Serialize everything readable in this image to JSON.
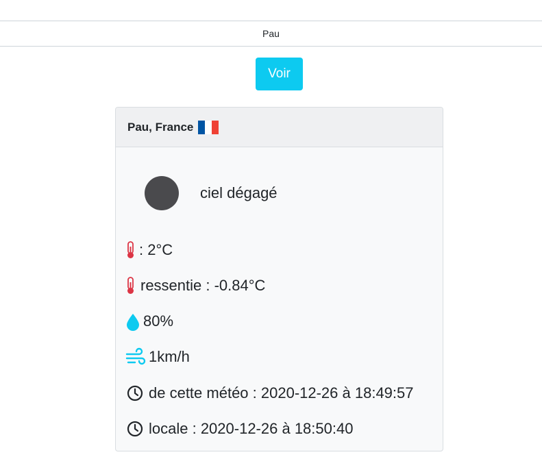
{
  "search": {
    "value": "Pau"
  },
  "button": {
    "label": "Voir"
  },
  "card": {
    "title": "Pau, France",
    "flag_colors": [
      "#0055A4",
      "#FFFFFF",
      "#EF4135"
    ],
    "weather": {
      "icon": "weather-icon-dark-circle",
      "description": "ciel dégagé"
    },
    "temperature": {
      "icon": "thermometer-icon",
      "text": ": 2°C"
    },
    "feels_like": {
      "icon": "thermometer-icon",
      "text": "ressentie : -0.84°C"
    },
    "humidity": {
      "icon": "droplet-icon",
      "text": "80%"
    },
    "wind": {
      "icon": "wind-icon",
      "text": "1km/h"
    },
    "observed_time": {
      "icon": "clock-icon",
      "text": "de cette météo : 2020-12-26 à 18:49:57"
    },
    "local_time": {
      "icon": "clock-icon",
      "text": "locale : 2020-12-26 à 18:50:40"
    }
  },
  "colors": {
    "button": "#0dcaf0",
    "thermometer": "#dc3545",
    "droplet": "#0dcaf0",
    "wind": "#0dcaf0",
    "clock": "#212529"
  }
}
